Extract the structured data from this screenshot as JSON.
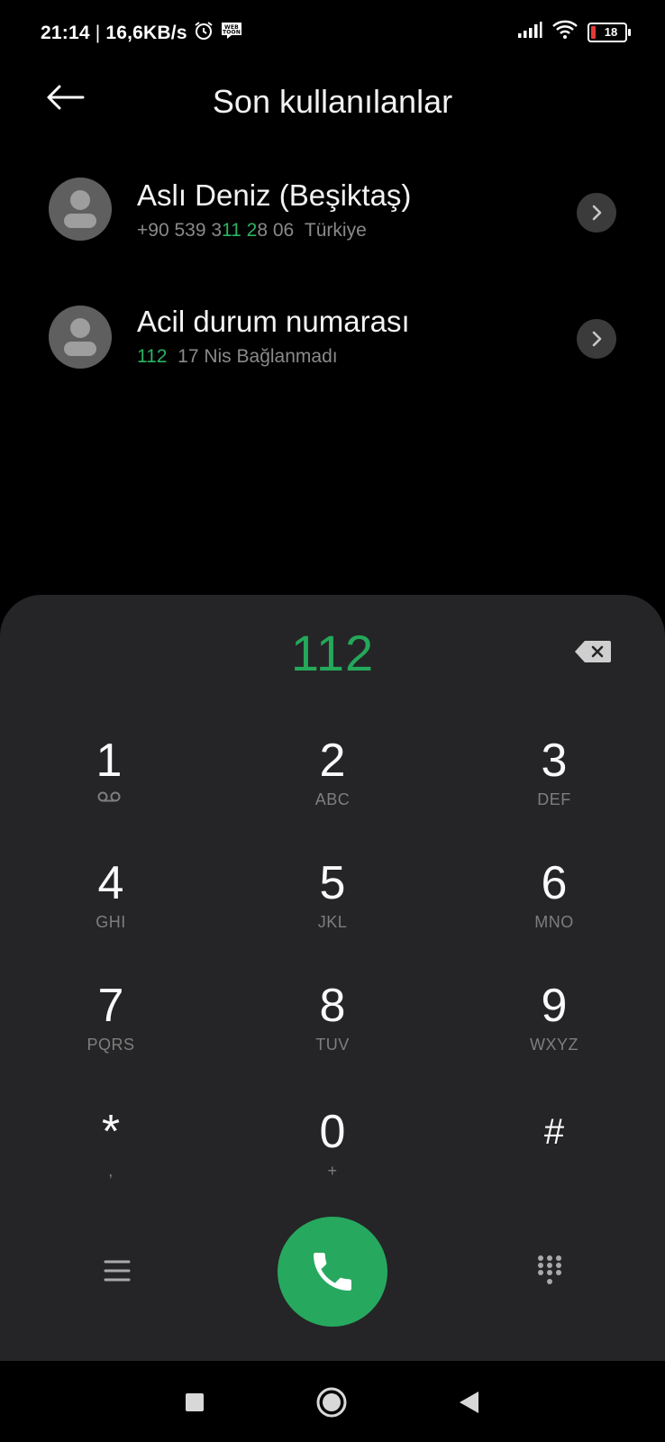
{
  "status_bar": {
    "time": "21:14",
    "separator": "|",
    "speed": "16,6KB/s",
    "battery_level": "18",
    "icons": [
      "alarm-icon",
      "webtoon-icon",
      "signal-icon",
      "wifi-icon",
      "battery-icon"
    ],
    "webtoon_text": "WEB TOON"
  },
  "header": {
    "title": "Son kullanılanlar",
    "back_icon": "back-arrow-icon"
  },
  "recent_calls": [
    {
      "name": "Aslı Deniz (Beşiktaş)",
      "number_parts": [
        "+90 539 3",
        "11",
        " ",
        "2",
        "8 06"
      ],
      "detail": "Türkiye"
    },
    {
      "name": "Acil durum numarası",
      "number": "112",
      "detail": "17 Nis Bağlanmadı"
    }
  ],
  "dialpad": {
    "dialed_number": "112",
    "keys": [
      {
        "digit": "1",
        "letters": ""
      },
      {
        "digit": "2",
        "letters": "ABC"
      },
      {
        "digit": "3",
        "letters": "DEF"
      },
      {
        "digit": "4",
        "letters": "GHI"
      },
      {
        "digit": "5",
        "letters": "JKL"
      },
      {
        "digit": "6",
        "letters": "MNO"
      },
      {
        "digit": "7",
        "letters": "PQRS"
      },
      {
        "digit": "8",
        "letters": "TUV"
      },
      {
        "digit": "9",
        "letters": "WXYZ"
      },
      {
        "digit": "*",
        "letters": ","
      },
      {
        "digit": "0",
        "letters": "+"
      },
      {
        "digit": "#",
        "letters": ""
      }
    ]
  },
  "colors": {
    "accent_green": "#27a85f",
    "panel_bg": "#252527",
    "battery_low": "#e53935"
  }
}
